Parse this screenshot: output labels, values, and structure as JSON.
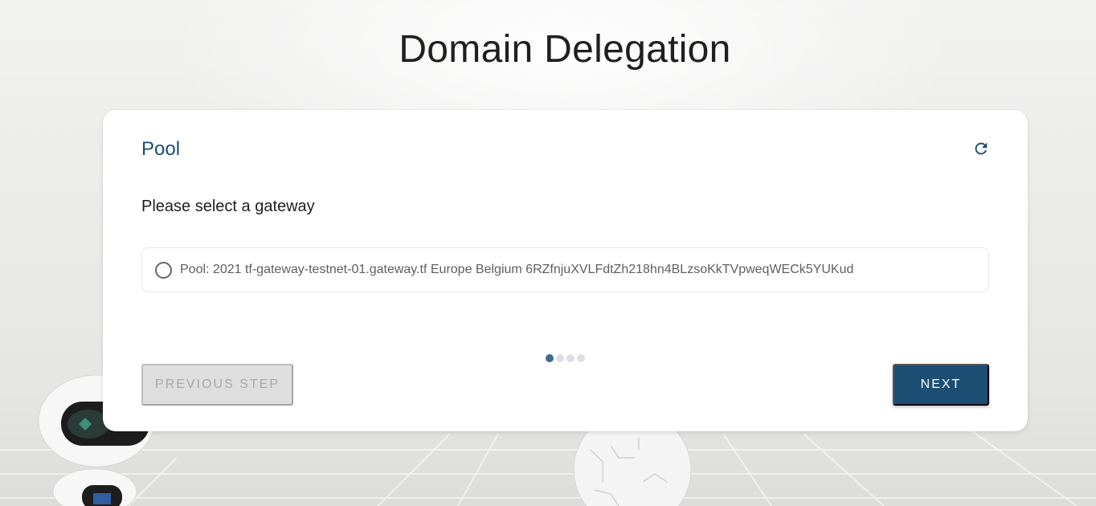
{
  "page": {
    "title": "Domain Delegation"
  },
  "card": {
    "title": "Pool",
    "prompt": "Please select a gateway",
    "refresh_icon": "refresh-icon",
    "options": [
      {
        "label": "Pool: 2021 tf-gateway-testnet-01.gateway.tf Europe Belgium 6RZfnjuXVLFdtZh218hn4BLzsoKkTVpweqWECk5YUKud",
        "selected": false
      }
    ]
  },
  "stepper": {
    "total_steps": 4,
    "current_step": 1
  },
  "buttons": {
    "previous_label": "Previous Step",
    "next_label": "Next"
  },
  "colors": {
    "accent": "#1c4e74",
    "disabled_bg": "#dedede",
    "disabled_text": "#a8a8a8"
  }
}
